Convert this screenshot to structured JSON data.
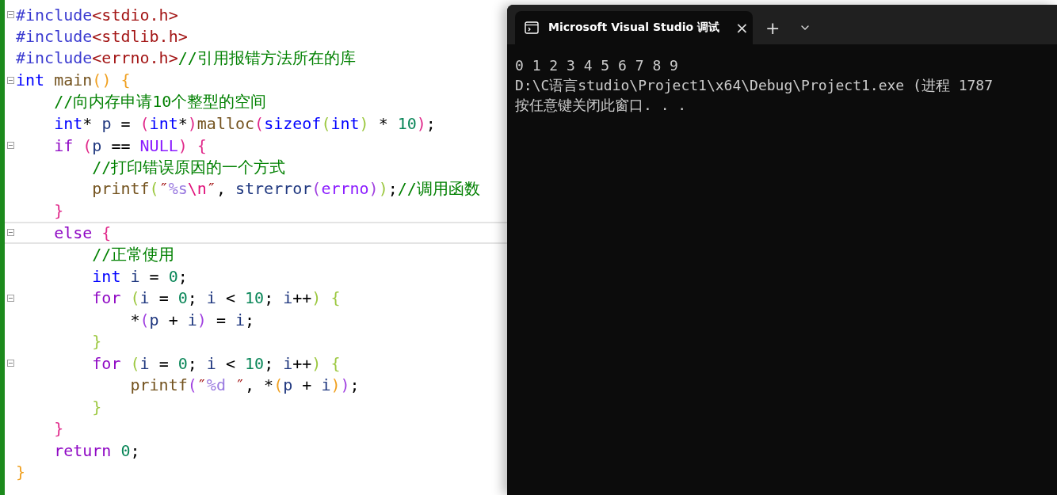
{
  "editor": {
    "lines": [
      {
        "fold": true,
        "current": false,
        "tokens": [
          {
            "kind": "pp",
            "text": "#include"
          },
          {
            "kind": "header",
            "text": "<stdio.h>"
          }
        ]
      },
      {
        "fold": false,
        "current": false,
        "tokens": [
          {
            "kind": "pp",
            "text": "#include"
          },
          {
            "kind": "header",
            "text": "<stdlib.h>"
          }
        ]
      },
      {
        "fold": false,
        "current": false,
        "tokens": [
          {
            "kind": "pp",
            "text": "#include"
          },
          {
            "kind": "header",
            "text": "<errno.h>"
          },
          {
            "kind": "comment",
            "text": "//引用报错方法所在的库"
          }
        ]
      },
      {
        "fold": true,
        "current": false,
        "tokens": [
          {
            "kind": "type",
            "text": "int"
          },
          {
            "kind": "func",
            "text": " main"
          },
          {
            "kind": "b1",
            "text": "()"
          },
          {
            "kind": "b1",
            "text": " {"
          }
        ]
      },
      {
        "fold": false,
        "current": false,
        "tokens": [
          {
            "kind": "comment",
            "text": "    //向内存申请10个整型的空间"
          }
        ]
      },
      {
        "fold": false,
        "current": false,
        "tokens": [
          {
            "kind": "type",
            "text": "    int"
          },
          {
            "kind": "plain",
            "text": "* "
          },
          {
            "kind": "ident",
            "text": "p"
          },
          {
            "kind": "plain",
            "text": " = "
          },
          {
            "kind": "b2",
            "text": "("
          },
          {
            "kind": "type",
            "text": "int"
          },
          {
            "kind": "plain",
            "text": "*"
          },
          {
            "kind": "b2",
            "text": ")"
          },
          {
            "kind": "func",
            "text": "malloc"
          },
          {
            "kind": "b2",
            "text": "("
          },
          {
            "kind": "type",
            "text": "sizeof"
          },
          {
            "kind": "b4",
            "text": "("
          },
          {
            "kind": "type",
            "text": "int"
          },
          {
            "kind": "b4",
            "text": ")"
          },
          {
            "kind": "plain",
            "text": " * "
          },
          {
            "kind": "num",
            "text": "10"
          },
          {
            "kind": "b2",
            "text": ")"
          },
          {
            "kind": "plain",
            "text": ";"
          }
        ]
      },
      {
        "fold": true,
        "current": false,
        "tokens": [
          {
            "kind": "ctrl",
            "text": "    if"
          },
          {
            "kind": "b2",
            "text": " ("
          },
          {
            "kind": "ident",
            "text": "p"
          },
          {
            "kind": "plain",
            "text": " == "
          },
          {
            "kind": "macro",
            "text": "NULL"
          },
          {
            "kind": "b2",
            "text": ")"
          },
          {
            "kind": "b2",
            "text": " {"
          }
        ]
      },
      {
        "fold": false,
        "current": false,
        "tokens": [
          {
            "kind": "comment",
            "text": "        //打印错误原因的一个方式"
          }
        ]
      },
      {
        "fold": false,
        "current": false,
        "tokens": [
          {
            "kind": "func",
            "text": "        printf"
          },
          {
            "kind": "b4",
            "text": "("
          },
          {
            "kind": "str",
            "text": "″"
          },
          {
            "kind": "fmt",
            "text": "%s"
          },
          {
            "kind": "esc",
            "text": "\\n"
          },
          {
            "kind": "str",
            "text": "″"
          },
          {
            "kind": "plain",
            "text": ", "
          },
          {
            "kind": "ident",
            "text": "strerror"
          },
          {
            "kind": "b3",
            "text": "("
          },
          {
            "kind": "macro",
            "text": "errno"
          },
          {
            "kind": "b3",
            "text": ")"
          },
          {
            "kind": "b4",
            "text": ")"
          },
          {
            "kind": "plain",
            "text": ";"
          },
          {
            "kind": "comment",
            "text": "//调用函数"
          }
        ]
      },
      {
        "fold": false,
        "current": false,
        "tokens": [
          {
            "kind": "b2",
            "text": "    }"
          }
        ]
      },
      {
        "fold": true,
        "current": true,
        "tokens": [
          {
            "kind": "ctrl",
            "text": "    else"
          },
          {
            "kind": "b2",
            "text": " {"
          }
        ]
      },
      {
        "fold": false,
        "current": false,
        "tokens": [
          {
            "kind": "comment",
            "text": "        //正常使用"
          }
        ]
      },
      {
        "fold": false,
        "current": false,
        "tokens": [
          {
            "kind": "type",
            "text": "        int"
          },
          {
            "kind": "ident",
            "text": " i"
          },
          {
            "kind": "plain",
            "text": " = "
          },
          {
            "kind": "num",
            "text": "0"
          },
          {
            "kind": "plain",
            "text": ";"
          }
        ]
      },
      {
        "fold": true,
        "current": false,
        "tokens": [
          {
            "kind": "ctrl",
            "text": "        for"
          },
          {
            "kind": "b4",
            "text": " ("
          },
          {
            "kind": "ident",
            "text": "i"
          },
          {
            "kind": "plain",
            "text": " = "
          },
          {
            "kind": "num",
            "text": "0"
          },
          {
            "kind": "plain",
            "text": "; "
          },
          {
            "kind": "ident",
            "text": "i"
          },
          {
            "kind": "plain",
            "text": " < "
          },
          {
            "kind": "num",
            "text": "10"
          },
          {
            "kind": "plain",
            "text": "; "
          },
          {
            "kind": "ident",
            "text": "i"
          },
          {
            "kind": "plain",
            "text": "++"
          },
          {
            "kind": "b4",
            "text": ")"
          },
          {
            "kind": "b4",
            "text": " {"
          }
        ]
      },
      {
        "fold": false,
        "current": false,
        "tokens": [
          {
            "kind": "plain",
            "text": "            *"
          },
          {
            "kind": "b3",
            "text": "("
          },
          {
            "kind": "ident",
            "text": "p"
          },
          {
            "kind": "plain",
            "text": " + "
          },
          {
            "kind": "ident",
            "text": "i"
          },
          {
            "kind": "b3",
            "text": ")"
          },
          {
            "kind": "plain",
            "text": " = "
          },
          {
            "kind": "ident",
            "text": "i"
          },
          {
            "kind": "plain",
            "text": ";"
          }
        ]
      },
      {
        "fold": false,
        "current": false,
        "tokens": [
          {
            "kind": "b4",
            "text": "        }"
          }
        ]
      },
      {
        "fold": true,
        "current": false,
        "tokens": [
          {
            "kind": "ctrl",
            "text": "        for"
          },
          {
            "kind": "b4",
            "text": " ("
          },
          {
            "kind": "ident",
            "text": "i"
          },
          {
            "kind": "plain",
            "text": " = "
          },
          {
            "kind": "num",
            "text": "0"
          },
          {
            "kind": "plain",
            "text": "; "
          },
          {
            "kind": "ident",
            "text": "i"
          },
          {
            "kind": "plain",
            "text": " < "
          },
          {
            "kind": "num",
            "text": "10"
          },
          {
            "kind": "plain",
            "text": "; "
          },
          {
            "kind": "ident",
            "text": "i"
          },
          {
            "kind": "plain",
            "text": "++"
          },
          {
            "kind": "b4",
            "text": ")"
          },
          {
            "kind": "b4",
            "text": " {"
          }
        ]
      },
      {
        "fold": false,
        "current": false,
        "tokens": [
          {
            "kind": "func",
            "text": "            printf"
          },
          {
            "kind": "b3",
            "text": "("
          },
          {
            "kind": "str",
            "text": "″"
          },
          {
            "kind": "fmt",
            "text": "%d"
          },
          {
            "kind": "str",
            "text": " ″"
          },
          {
            "kind": "plain",
            "text": ", *"
          },
          {
            "kind": "b1",
            "text": "("
          },
          {
            "kind": "ident",
            "text": "p"
          },
          {
            "kind": "plain",
            "text": " + "
          },
          {
            "kind": "ident",
            "text": "i"
          },
          {
            "kind": "b1",
            "text": ")"
          },
          {
            "kind": "b3",
            "text": ")"
          },
          {
            "kind": "plain",
            "text": ";"
          }
        ]
      },
      {
        "fold": false,
        "current": false,
        "tokens": [
          {
            "kind": "b4",
            "text": "        }"
          }
        ]
      },
      {
        "fold": false,
        "current": false,
        "tokens": [
          {
            "kind": "b2",
            "text": "    }"
          }
        ]
      },
      {
        "fold": false,
        "current": false,
        "tokens": [
          {
            "kind": "ctrl",
            "text": "    return"
          },
          {
            "kind": "num",
            "text": " 0"
          },
          {
            "kind": "plain",
            "text": ";"
          }
        ]
      },
      {
        "fold": false,
        "current": false,
        "tokens": [
          {
            "kind": "b1",
            "text": "}"
          }
        ]
      }
    ]
  },
  "terminal": {
    "tab": {
      "title": "Microsoft Visual Studio 调试",
      "close": "×",
      "selected": true
    },
    "new_tab": "+",
    "output": [
      "0 1 2 3 4 5 6 7 8 9",
      "D:\\C语言studio\\Project1\\x64\\Debug\\Project1.exe (进程 1787",
      "按任意键关闭此窗口. . ."
    ]
  }
}
